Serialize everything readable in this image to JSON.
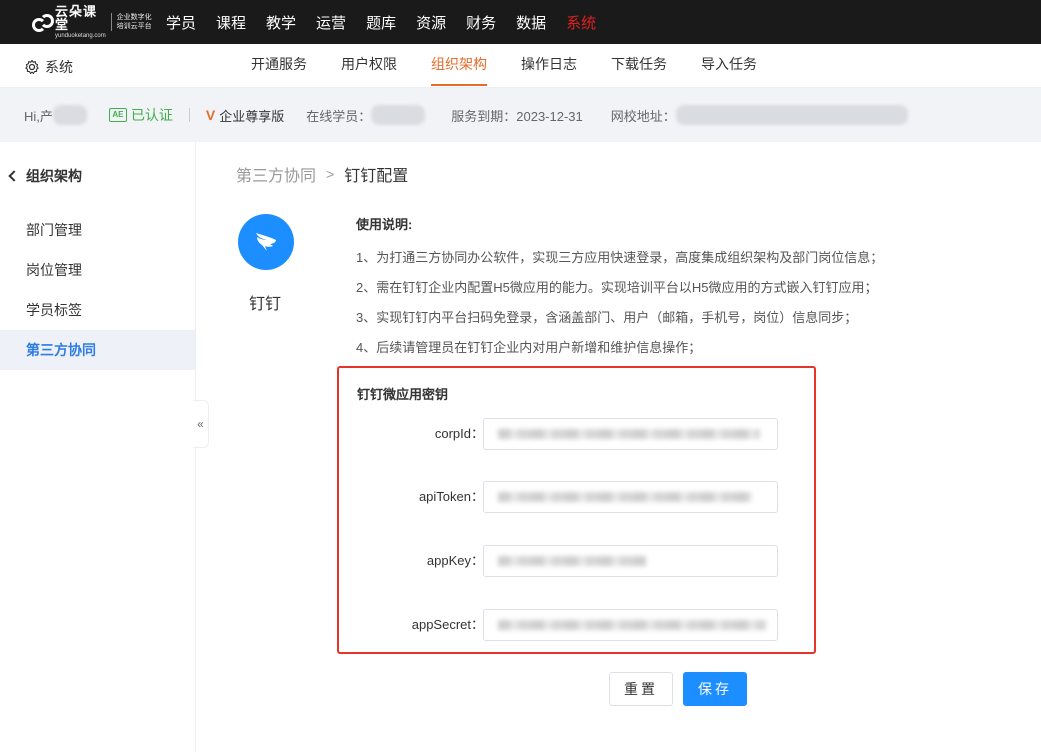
{
  "app": {
    "logo_main": "云朵课堂",
    "logo_sub": "yunduoketang.com",
    "logo_tag": "企业数字化培训云平台"
  },
  "topnav": {
    "items": [
      {
        "label": "学员"
      },
      {
        "label": "课程"
      },
      {
        "label": "教学"
      },
      {
        "label": "运营"
      },
      {
        "label": "题库"
      },
      {
        "label": "资源"
      },
      {
        "label": "财务"
      },
      {
        "label": "数据"
      },
      {
        "label": "系统",
        "active": true
      }
    ]
  },
  "subnav": {
    "section": "系统",
    "tabs": [
      {
        "label": "开通服务"
      },
      {
        "label": "用户权限"
      },
      {
        "label": "组织架构",
        "active": true
      },
      {
        "label": "操作日志"
      },
      {
        "label": "下载任务"
      },
      {
        "label": "导入任务"
      }
    ]
  },
  "infobar": {
    "greeting": "Hi,产",
    "verified": "已认证",
    "verified_badge": "AE",
    "edition_mark": "V",
    "edition": "企业尊享版",
    "online_label": "在线学员：",
    "expire": "服务到期：2023-12-31",
    "school_label": "网校地址："
  },
  "sidebar": {
    "title": "组织架构",
    "items": [
      {
        "label": "部门管理"
      },
      {
        "label": "岗位管理"
      },
      {
        "label": "学员标签"
      },
      {
        "label": "第三方协同",
        "active": true
      }
    ],
    "collapse": "«"
  },
  "breadcrumb": {
    "parent": "第三方协同",
    "separator": ">",
    "current": "钉钉配置"
  },
  "integration": {
    "name": "钉钉"
  },
  "usage": {
    "title": "使用说明:",
    "lines": [
      "1、为打通三方协同办公软件，实现三方应用快速登录，高度集成组织架构及部门岗位信息；",
      "2、需在钉钉企业内配置H5微应用的能力。实现培训平台以H5微应用的方式嵌入钉钉应用；",
      "3、实现钉钉内平台扫码免登录，含涵盖部门、用户（邮箱，手机号，岗位）信息同步；",
      "4、后续请管理员在钉钉企业内对用户新增和维护信息操作；"
    ]
  },
  "keys": {
    "title": "钉钉微应用密钥",
    "fields": [
      {
        "label": "corpId：",
        "value": "ding"
      },
      {
        "label": "apiToken：",
        "value": ""
      },
      {
        "label": "appKey：",
        "value": ""
      },
      {
        "label": "appSecret：",
        "value": ""
      }
    ]
  },
  "actions": {
    "reset": "重置",
    "save": "保存"
  },
  "colors": {
    "topbar_bg": "#1a1a1a",
    "active_nav": "#e02020",
    "accent_orange": "#e56c2c",
    "primary_blue": "#1d8eff",
    "highlight_red": "#e5342a",
    "verified_green": "#3fb14a"
  }
}
